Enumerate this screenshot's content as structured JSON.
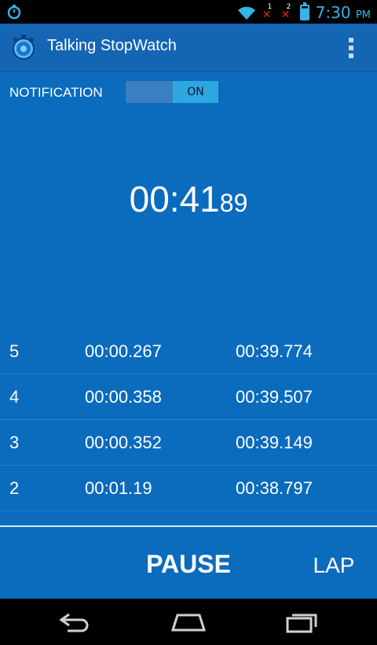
{
  "status_bar": {
    "time": "7:30",
    "ampm": "PM",
    "sim1": "1",
    "sim2": "2",
    "icons": [
      "stopwatch-icon",
      "wifi-icon",
      "no-signal-icon",
      "battery-icon"
    ],
    "accent": "#33b5e5"
  },
  "app_bar": {
    "title": "Talking StopWatch",
    "color": "#1565b5"
  },
  "notification": {
    "label": "NOTIFICATION",
    "toggle_state": "ON"
  },
  "timer": {
    "main": "00:41",
    "fraction": "89"
  },
  "laps": [
    {
      "number": "5",
      "lap_time": "00:00.267",
      "total_time": "00:39.774"
    },
    {
      "number": "4",
      "lap_time": "00:00.358",
      "total_time": "00:39.507"
    },
    {
      "number": "3",
      "lap_time": "00:00.352",
      "total_time": "00:39.149"
    },
    {
      "number": "2",
      "lap_time": "00:01.19",
      "total_time": "00:38.797"
    }
  ],
  "controls": {
    "pause_label": "PAUSE",
    "lap_label": "LAP"
  },
  "content_bg": "#0b6bbd"
}
